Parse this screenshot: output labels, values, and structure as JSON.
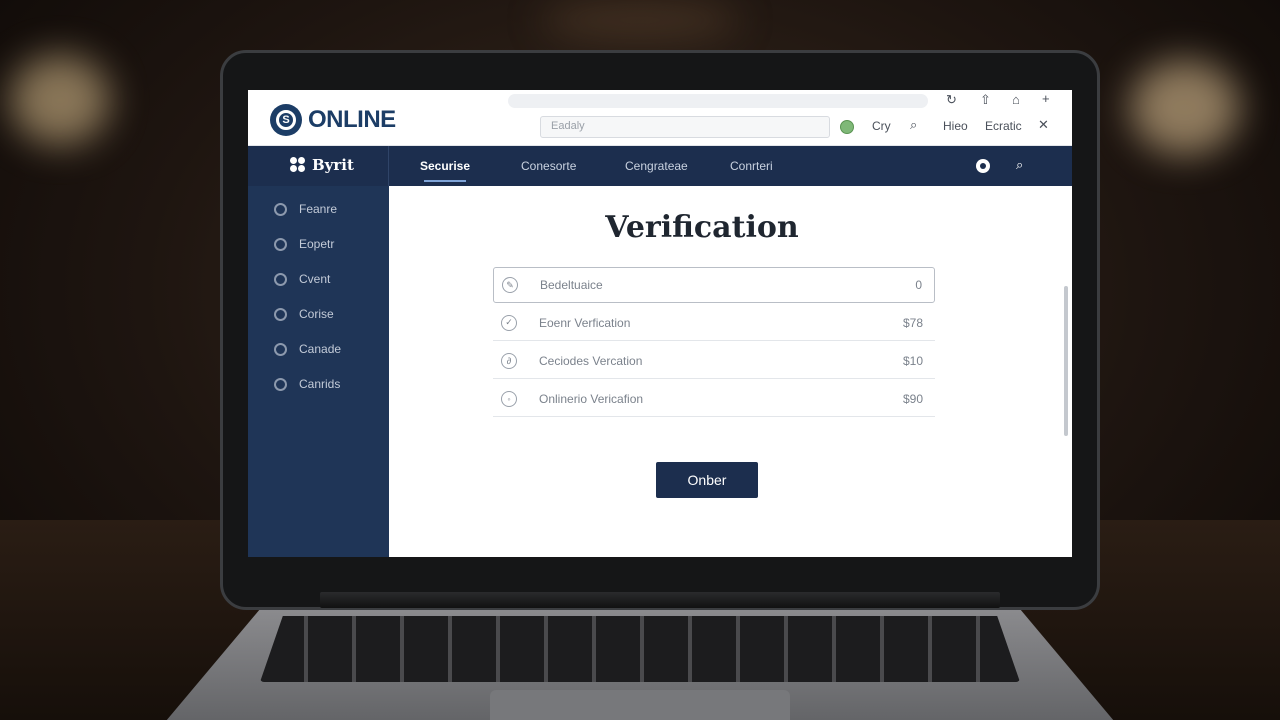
{
  "browser": {
    "icons": [
      "reload-icon",
      "share-icon",
      "home-icon",
      "new-tab-icon"
    ]
  },
  "header": {
    "logo_text": "ONLINE",
    "search_placeholder": "Eadaly",
    "links": [
      "Cry",
      "Hieo",
      "Ecratic"
    ]
  },
  "navbar": {
    "brand": "Byrit",
    "tabs": [
      "Securise",
      "Conesorte",
      "Cengrateae",
      "Conrteri"
    ]
  },
  "sidebar": {
    "items": [
      "Feanre",
      "Eopetr",
      "Cvent",
      "Corise",
      "Canade",
      "Canrids"
    ]
  },
  "main": {
    "title": "Verification",
    "rows": [
      {
        "label": "Bedeltuaice",
        "value": "0"
      },
      {
        "label": "Eoenr Verfication",
        "value": "$78"
      },
      {
        "label": "Ceciodes Vercation",
        "value": "$10"
      },
      {
        "label": "Onlinerio Vericafion",
        "value": "$90"
      }
    ],
    "button_label": "Onber"
  },
  "colors": {
    "navy": "#1c2e4e",
    "sidebar": "#1f3557",
    "brand_blue": "#1c3d66"
  }
}
